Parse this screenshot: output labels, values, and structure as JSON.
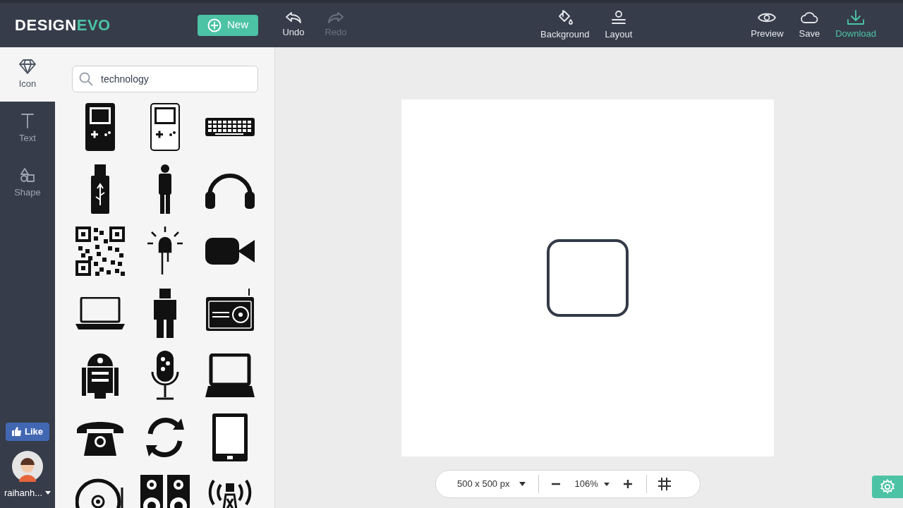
{
  "logo": {
    "part_1": "DESIGN",
    "part_2": "EVO"
  },
  "new_button": "New",
  "history": [
    {
      "label": "Undo",
      "disabled": false
    },
    {
      "label": "Redo",
      "disabled": true
    }
  ],
  "canvas_tools": [
    {
      "label": "Background"
    },
    {
      "label": "Layout"
    }
  ],
  "actions": [
    {
      "label": "Preview",
      "highlighted": false
    },
    {
      "label": "Save",
      "highlighted": false
    },
    {
      "label": "Download",
      "highlighted": true
    }
  ],
  "sidebar": {
    "tabs": [
      {
        "label": "Icon",
        "selected": true
      },
      {
        "label": "Text",
        "selected": false
      },
      {
        "label": "Shape",
        "selected": false
      }
    ],
    "like_button": "Like",
    "user": "raihanh..."
  },
  "search": {
    "value": "technology"
  },
  "bottom_bar": {
    "size": "500 x 500 px",
    "zoom": "106%"
  }
}
